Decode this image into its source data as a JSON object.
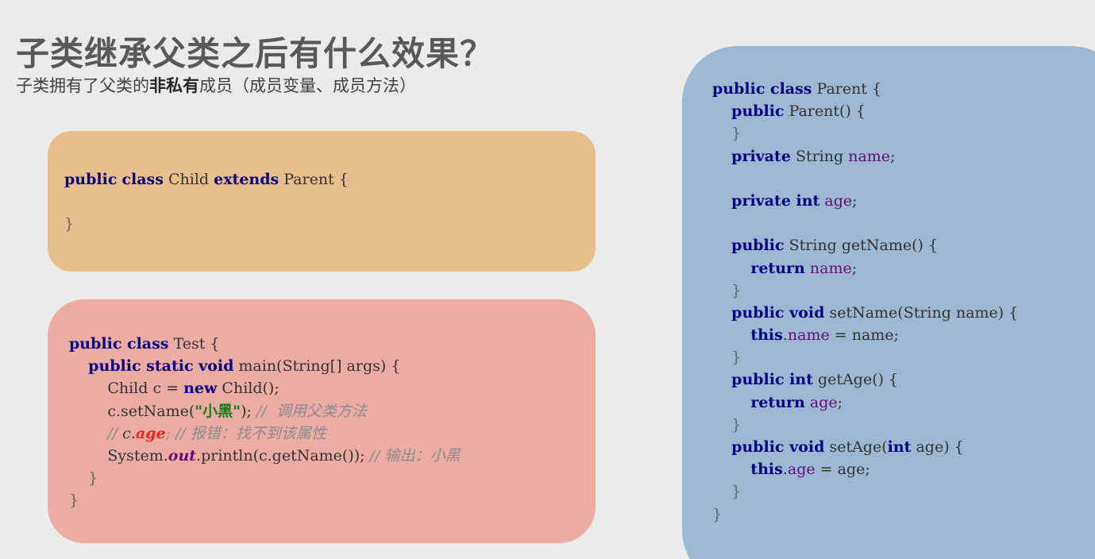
{
  "heading": {
    "title": "子类继承父类之后有什么效果？",
    "subtitle_prefix": "子类拥有了父类的",
    "subtitle_bold": "非私有",
    "subtitle_suffix": "成员（成员变量、成员方法）"
  },
  "child_code": {
    "kw_public": "public",
    "kw_class": "class",
    "class_name": "Child",
    "kw_extends": "extends",
    "parent_name": "Parent {",
    "close": "}"
  },
  "test_code": {
    "l1_kw": "public class",
    "l1_rest": " Test {",
    "l2_kw": "public static void",
    "l2_rest": " main(String[] args) {",
    "l3_a": "Child c = ",
    "l3_kw": "new",
    "l3_b": " Child();",
    "l4_a": "c.setName(",
    "l4_str": "\"小黑\"",
    "l4_b": "); ",
    "l4_cmt": "//  调用父类方法",
    "l5_cmt1": "// ",
    "l5_obj": "c.",
    "l5_err": "age",
    "l5_cmt2": "; // 报错：找不到该属性",
    "l6_a": "System.",
    "l6_field": "out",
    "l6_b": ".println(c.getName()); ",
    "l6_cmt": "// 输出：小黑",
    "l7": "}",
    "l8": "}"
  },
  "parent_code": {
    "p1_kw": "public class",
    "p1_rest": " Parent {",
    "p2_kw": "public",
    "p2_rest": " Parent() {",
    "p3": "}",
    "p4_kw": "private",
    "p4_type": " String ",
    "p4_field": "name",
    "p4_end": ";",
    "p6_kw": "private int",
    "p6_field": "age",
    "p6_end": ";",
    "p8_kw": "public",
    "p8_rest": " String getName() {",
    "p9_kw": "return",
    "p9_field": "name",
    "p9_end": ";",
    "p10": "}",
    "p11_kw": "public void",
    "p11_rest": " setName(String name) {",
    "p12_kw": "this",
    "p12_field": "name",
    "p12_rest": " = name;",
    "p13": "}",
    "p14_kw": "public int",
    "p14_rest": " getAge() {",
    "p15_kw": "return",
    "p15_field": "age",
    "p15_end": ";",
    "p16": "}",
    "p17_kw": "public void",
    "p17_a": " setAge(",
    "p17_kw2": "int",
    "p17_b": " age) {",
    "p18_kw": "this",
    "p18_field": "age",
    "p18_rest": " = age;",
    "p19": "}",
    "p20": "}"
  },
  "colors": {
    "child_card": "#eabe8c",
    "test_card": "#ecaba3",
    "parent_card": "#9db8d2",
    "keyword": "#000080",
    "field": "#660e7a",
    "string": "#1a7a1a",
    "comment": "#8c8c8c",
    "error": "#e22222"
  }
}
